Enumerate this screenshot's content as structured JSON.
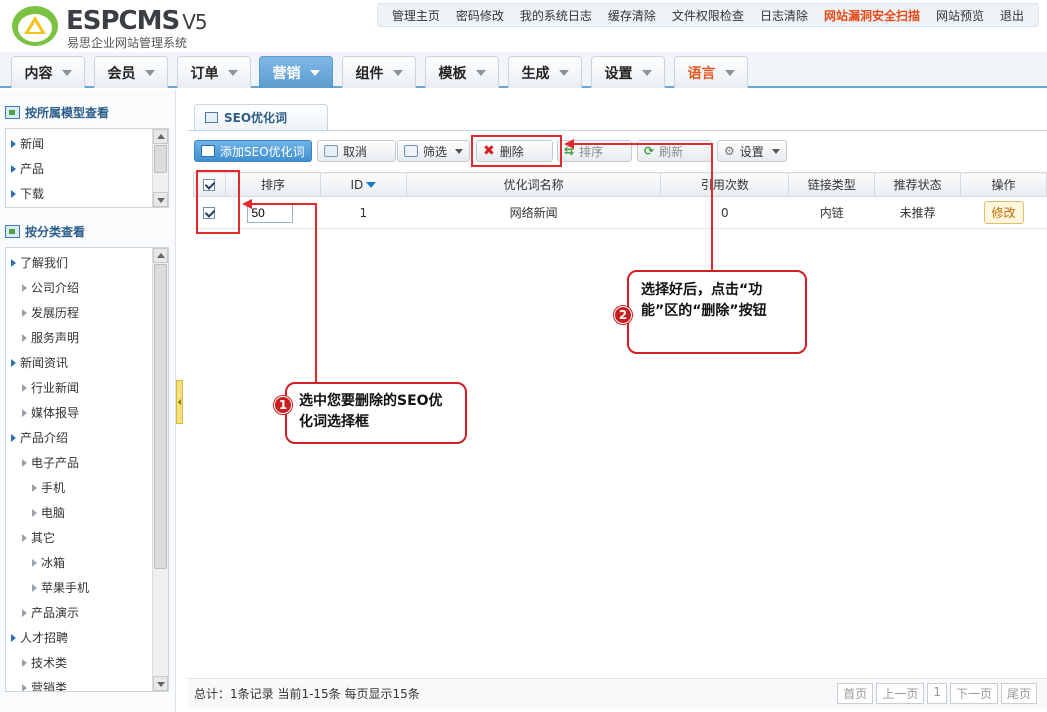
{
  "header": {
    "brand": "ESPCMS",
    "version": "V5",
    "subtitle": "易思企业网站管理系统",
    "topnav": [
      "管理主页",
      "密码修改",
      "我的系统日志",
      "缓存清除",
      "文件权限检查",
      "日志清除",
      "网站漏洞安全扫描",
      "网站预览",
      "退出"
    ]
  },
  "main_tabs": [
    "内容",
    "会员",
    "订单",
    "营销",
    "组件",
    "模板",
    "生成",
    "设置",
    "语言"
  ],
  "sidebar": {
    "section1_title": "按所属模型查看",
    "section1_items": [
      "新闻",
      "产品",
      "下载"
    ],
    "section2_title": "按分类查看",
    "section2_items": [
      "了解我们",
      "公司介绍",
      "发展历程",
      "服务声明",
      "新闻资讯",
      "行业新闻",
      "媒体报导",
      "产品介绍",
      "电子产品",
      "手机",
      "电脑",
      "其它",
      "冰箱",
      "苹果手机",
      "产品演示",
      "人才招聘",
      "技术类",
      "营销类"
    ]
  },
  "content": {
    "tab_label": "SEO优化词",
    "toolbar": {
      "add": "添加SEO优化词",
      "cancel": "取消",
      "filter": "筛选",
      "delete": "删除",
      "sort": "排序",
      "refresh": "刷新",
      "settings": "设置"
    },
    "columns": [
      "排序",
      "ID",
      "优化词名称",
      "引用次数",
      "链接类型",
      "推荐状态",
      "操作"
    ],
    "rows": [
      {
        "sort": "50",
        "id": "1",
        "name": "网络新闻",
        "refs": "0",
        "link_type": "内链",
        "recommend": "未推荐",
        "action": "修改"
      }
    ],
    "footer_stat": "总计：1条记录 当前1-15条 每页显示15条",
    "pager": [
      "首页",
      "上一页",
      "1",
      "下一页",
      "尾页"
    ]
  },
  "annotations": {
    "step1_num": "1",
    "step1_text": "选中您要删除的SEO优化词选择框",
    "step2_num": "2",
    "step2_text": "选择好后，点击“功能”区的“删除”按钮"
  },
  "colors": {
    "accent": "#5b9ccf",
    "warn": "#e64a19",
    "annotation": "#e2292e"
  }
}
